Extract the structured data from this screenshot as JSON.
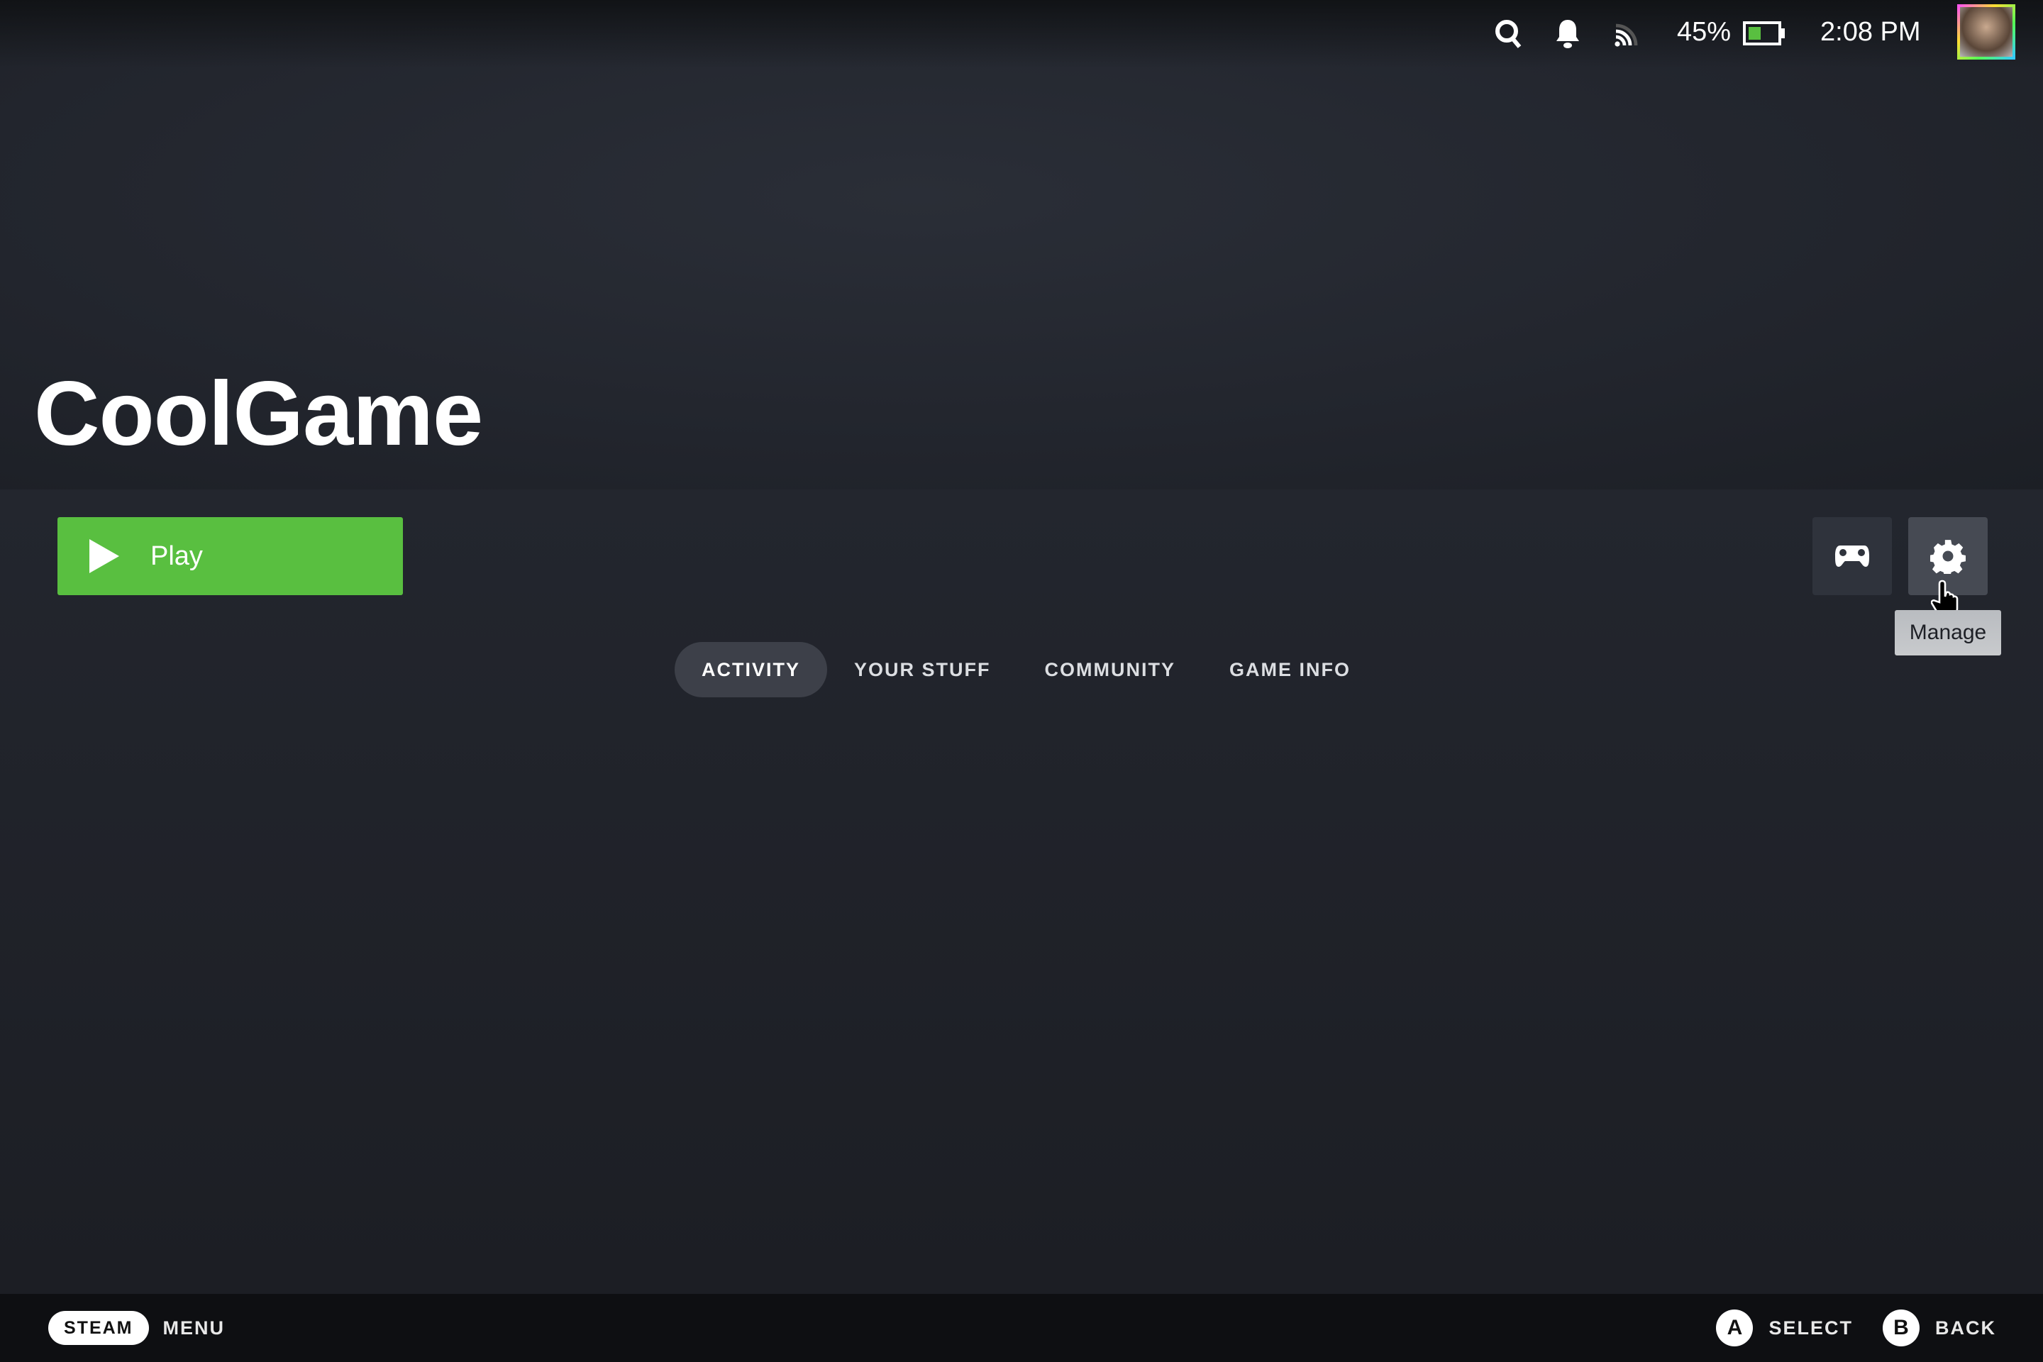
{
  "status_bar": {
    "battery_percent_label": "45%",
    "battery_level": 0.45,
    "time": "2:08 PM",
    "icons": [
      "search-icon",
      "bell-icon",
      "cast-icon",
      "battery-icon",
      "avatar"
    ]
  },
  "game": {
    "title": "CoolGame",
    "play_label": "Play"
  },
  "actions": {
    "controller_icon": "controller-icon",
    "manage_icon": "gear-icon",
    "tooltip": "Manage"
  },
  "tabs": [
    {
      "label": "ACTIVITY",
      "active": true
    },
    {
      "label": "YOUR STUFF"
    },
    {
      "label": "COMMUNITY"
    },
    {
      "label": "GAME INFO"
    }
  ],
  "footer": {
    "steam_label": "STEAM",
    "menu_label": "MENU",
    "a_glyph": "A",
    "select_label": "SELECT",
    "b_glyph": "B",
    "back_label": "BACK"
  },
  "colors": {
    "play": "#59bf40",
    "battery": "#59bf40"
  }
}
